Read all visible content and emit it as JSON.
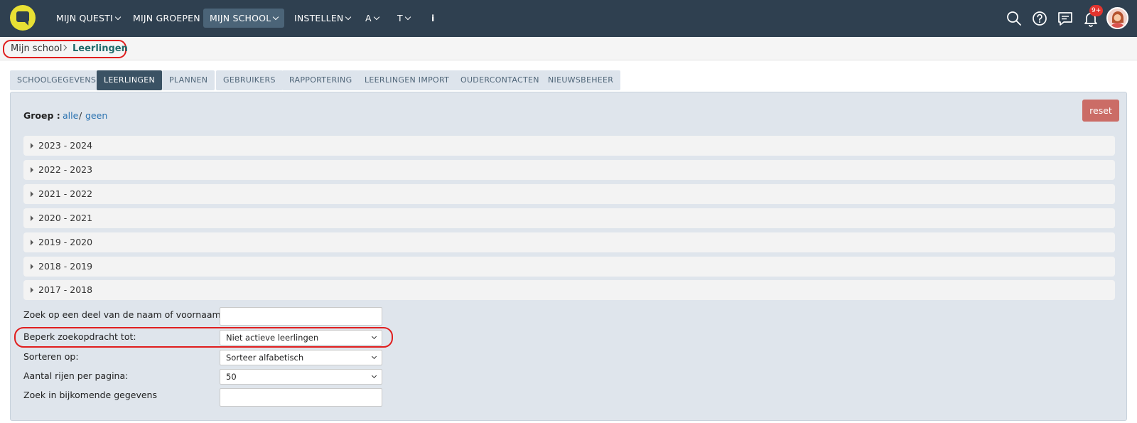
{
  "topnav": {
    "items": [
      {
        "label": "MIJN QUESTI",
        "has_dropdown": true
      },
      {
        "label": "MIJN GROEPEN",
        "has_dropdown": false
      },
      {
        "label": "MIJN SCHOOL",
        "has_dropdown": true,
        "active": true
      },
      {
        "label": "INSTELLEN",
        "has_dropdown": true
      },
      {
        "label": "A",
        "has_dropdown": true
      },
      {
        "label": "T",
        "has_dropdown": true
      },
      {
        "label": "i",
        "has_dropdown": false
      }
    ],
    "icons": [
      "search-icon",
      "help-icon",
      "chat-icon",
      "bell-icon"
    ],
    "notification_badge": "9+"
  },
  "breadcrumb": {
    "home": "Mijn school",
    "current": "Leerlingen"
  },
  "tabs": [
    {
      "label": "SCHOOLGEGEVENS"
    },
    {
      "label": "LEERLINGEN",
      "active": true
    },
    {
      "label": "PLANNEN"
    },
    {
      "label": "GEBRUIKERS"
    },
    {
      "label": "RAPPORTERING"
    },
    {
      "label": "LEERLINGEN IMPORT"
    },
    {
      "label": "OUDERCONTACTEN"
    },
    {
      "label": "NIEUWSBEHEER"
    }
  ],
  "filters": {
    "groep_label": "Groep :",
    "all_link": "alle",
    "separator": "/",
    "none_link": "geen",
    "reset_label": "reset"
  },
  "years": [
    "2023 - 2024",
    "2022 - 2023",
    "2021 - 2022",
    "2020 - 2021",
    "2019 - 2020",
    "2018 - 2019",
    "2017 - 2018"
  ],
  "form": {
    "search_name_label": "Zoek op een deel van de naam of voornaam",
    "search_name_value": "",
    "limit_label": "Beperk zoekopdracht tot:",
    "limit_value": "Niet actieve leerlingen",
    "sort_label": "Sorteren op:",
    "sort_value": "Sorteer alfabetisch",
    "rows_label": "Aantal rijen per pagina:",
    "rows_value": "50",
    "extra_label": "Zoek in bijkomende gegevens",
    "extra_value": ""
  },
  "colors": {
    "nav_bg": "#2f4050",
    "logo": "#e8e034",
    "active_tab": "#3a5264",
    "reset": "#cb6c66",
    "highlight_ring": "#e01e1e",
    "link": "#2a72b0"
  }
}
